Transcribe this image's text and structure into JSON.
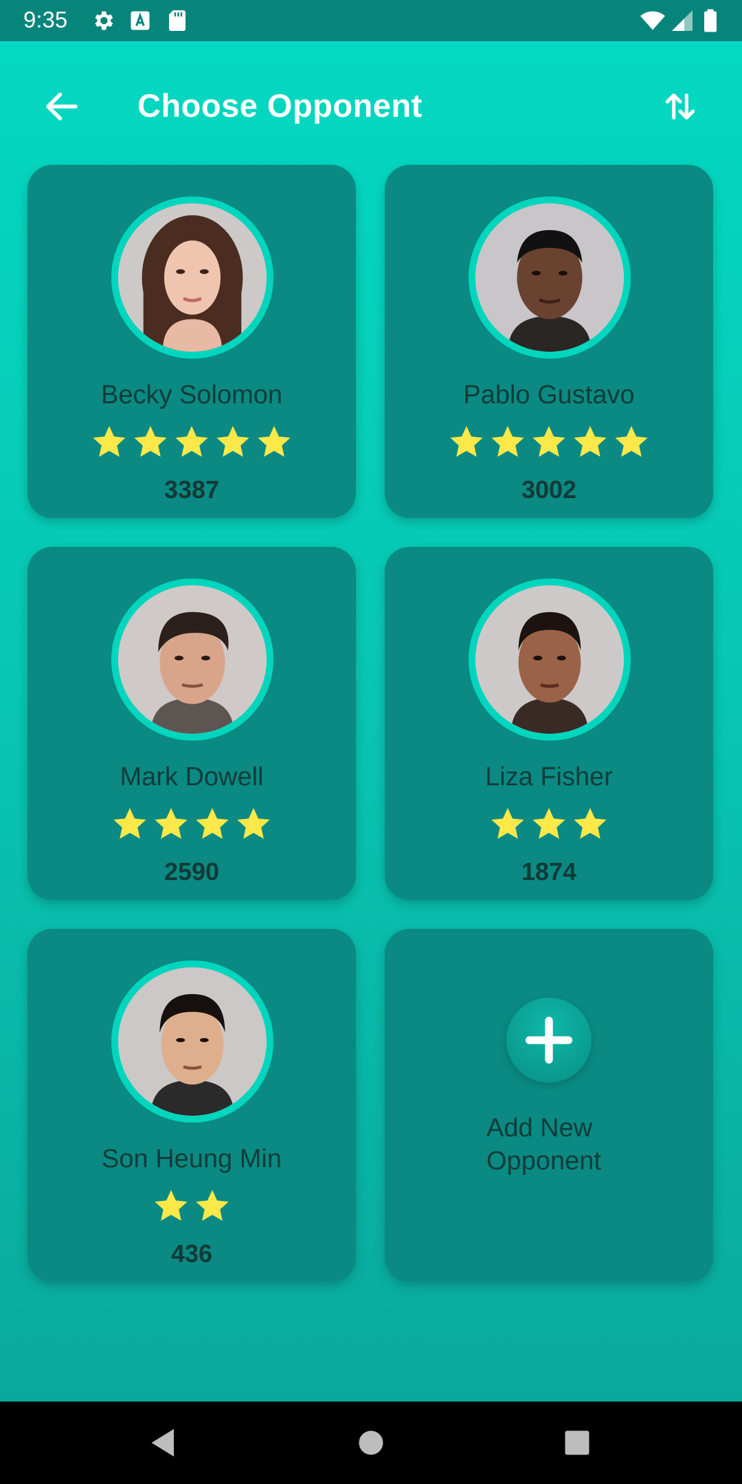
{
  "status_bar": {
    "time": "9:35",
    "icons": [
      "gear-icon",
      "text-recognition-icon",
      "sd-card-icon",
      "wifi-icon",
      "signal-icon",
      "battery-icon"
    ]
  },
  "header": {
    "title": "Choose Opponent",
    "back_icon": "arrow-left-icon",
    "sort_icon": "sort-arrows-icon"
  },
  "opponents": [
    {
      "name": "Becky Solomon",
      "stars": 5,
      "rating": "3387"
    },
    {
      "name": "Pablo Gustavo",
      "stars": 5,
      "rating": "3002"
    },
    {
      "name": "Mark Dowell",
      "stars": 4,
      "rating": "2590"
    },
    {
      "name": "Liza Fisher",
      "stars": 3,
      "rating": "1874"
    },
    {
      "name": "Son Heung Min",
      "stars": 2,
      "rating": "436"
    }
  ],
  "add_card": {
    "line1": "Add New",
    "line2": "Opponent",
    "icon": "plus-icon"
  },
  "nav_bar": {
    "icons": [
      "back-triangle-icon",
      "home-circle-icon",
      "recents-square-icon"
    ]
  },
  "colors": {
    "accent": "#00d6bd",
    "card": "#0a8a82",
    "star": "#fde84a",
    "status_bar": "#08857b"
  }
}
